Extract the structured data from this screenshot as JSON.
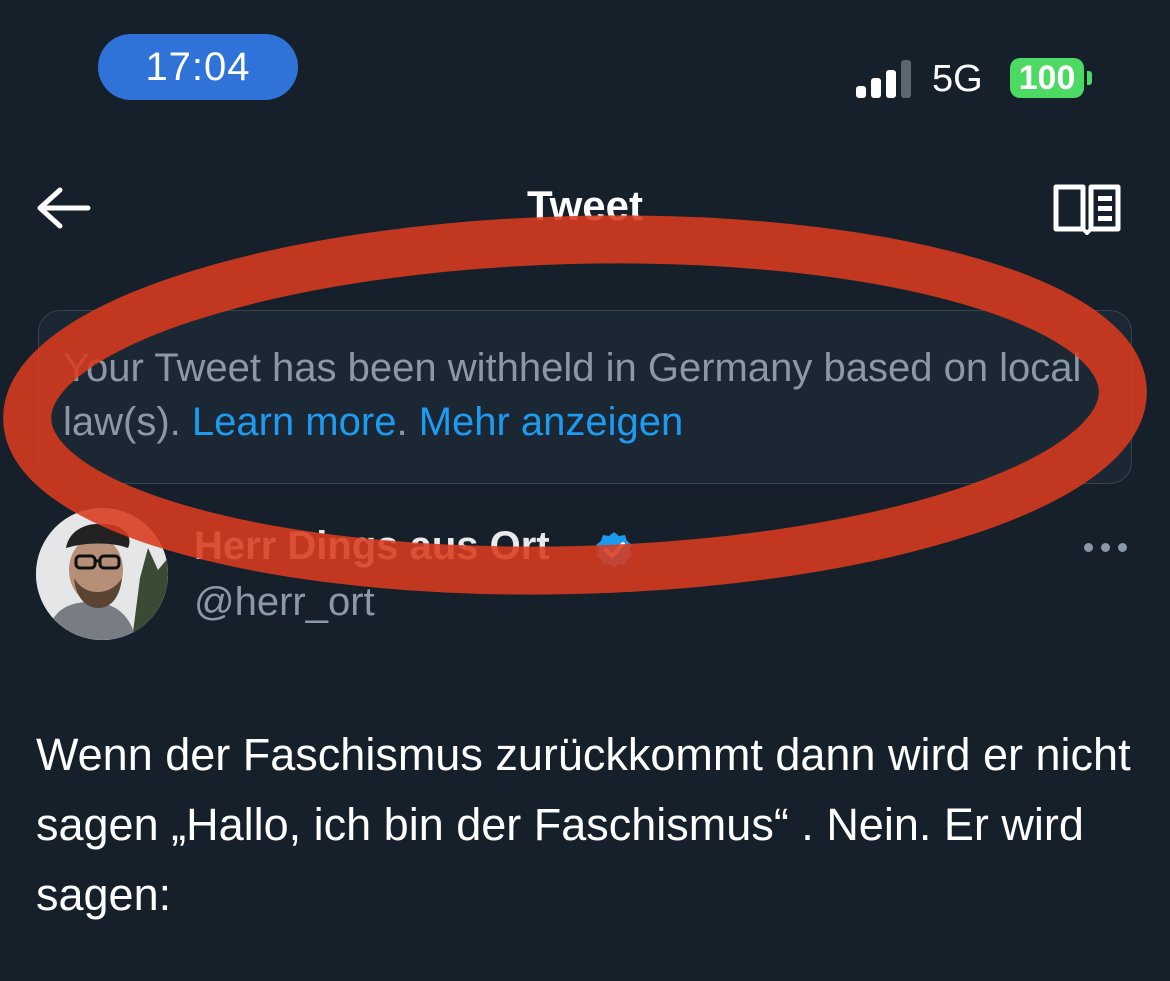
{
  "status_bar": {
    "time": "17:04",
    "network": "5G",
    "battery": "100",
    "signal_bars_filled": 3,
    "signal_bars_total": 4
  },
  "header": {
    "title": "Tweet",
    "back_icon": "arrow-left-icon",
    "reader_icon": "reader-mode-icon"
  },
  "notice": {
    "text": "Your Tweet has been withheld in Germany based on local law(s). ",
    "learn_more": "Learn more",
    "period": ". ",
    "show_more": "Mehr anzeigen"
  },
  "author": {
    "name": "Herr Dings aus Ort",
    "handle": "@herr_ort",
    "verified_icon": "verified-badge-icon"
  },
  "tweet": {
    "text": "Wenn der Faschismus zurückkommt dann wird er nicht sagen „Hallo, ich bin der Faschismus“ . Nein. Er wird sagen:"
  },
  "colors": {
    "background": "#15202b",
    "accent": "#1d9bf0",
    "annotation": "#d93a1e",
    "time_pill": "#2f73d9",
    "battery": "#4cd964"
  }
}
